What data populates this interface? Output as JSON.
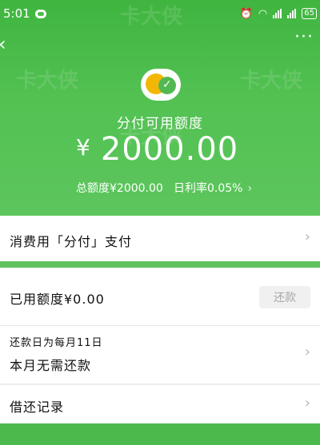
{
  "status_bar": {
    "time": "5:01",
    "battery": "65"
  },
  "header": {
    "back_icon": "back-arrow-icon",
    "more_icon": "more-dots-icon",
    "available_label": "分付可用额度",
    "currency": "¥",
    "available_amount": "2000.00",
    "total_limit": "总额度¥2000.00",
    "daily_rate": "日利率0.05%"
  },
  "pay_row": {
    "label": "消费用「分付」支付"
  },
  "credit": {
    "used_label": "已用额度¥0.00",
    "repay_button": "还款",
    "due_day": "还款日为每月11日",
    "status": "本月无需还款"
  },
  "history_row": {
    "label": "借还记录"
  },
  "colors": {
    "brand_green": "#52c152",
    "background": "#ededed"
  }
}
